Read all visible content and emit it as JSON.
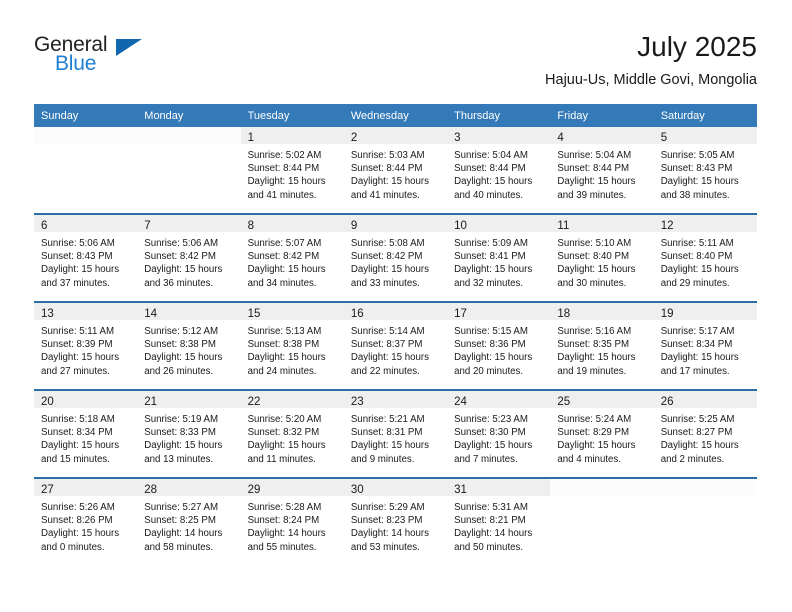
{
  "brand": {
    "name_part1": "General",
    "name_part2": "Blue",
    "triangle_color": "#1266ad",
    "blue_text_color": "#1c7fd4"
  },
  "header": {
    "month_title": "July 2025",
    "location": "Hajuu-Us, Middle Govi, Mongolia",
    "header_bg_color": "#3479b8",
    "row_divider_color": "#2d6ca5",
    "daynum_strip_color": "#efefef"
  },
  "weekday_headers": [
    "Sunday",
    "Monday",
    "Tuesday",
    "Wednesday",
    "Thursday",
    "Friday",
    "Saturday"
  ],
  "labels": {
    "sunrise_prefix": "Sunrise:",
    "sunset_prefix": "Sunset:",
    "daylight_prefix": "Daylight:"
  },
  "weeks": [
    [
      {
        "empty": true
      },
      {
        "empty": true
      },
      {
        "day": "1",
        "sunrise": "Sunrise: 5:02 AM",
        "sunset": "Sunset: 8:44 PM",
        "daylight_line1": "Daylight: 15 hours",
        "daylight_line2": "and 41 minutes."
      },
      {
        "day": "2",
        "sunrise": "Sunrise: 5:03 AM",
        "sunset": "Sunset: 8:44 PM",
        "daylight_line1": "Daylight: 15 hours",
        "daylight_line2": "and 41 minutes."
      },
      {
        "day": "3",
        "sunrise": "Sunrise: 5:04 AM",
        "sunset": "Sunset: 8:44 PM",
        "daylight_line1": "Daylight: 15 hours",
        "daylight_line2": "and 40 minutes."
      },
      {
        "day": "4",
        "sunrise": "Sunrise: 5:04 AM",
        "sunset": "Sunset: 8:44 PM",
        "daylight_line1": "Daylight: 15 hours",
        "daylight_line2": "and 39 minutes."
      },
      {
        "day": "5",
        "sunrise": "Sunrise: 5:05 AM",
        "sunset": "Sunset: 8:43 PM",
        "daylight_line1": "Daylight: 15 hours",
        "daylight_line2": "and 38 minutes."
      }
    ],
    [
      {
        "day": "6",
        "sunrise": "Sunrise: 5:06 AM",
        "sunset": "Sunset: 8:43 PM",
        "daylight_line1": "Daylight: 15 hours",
        "daylight_line2": "and 37 minutes."
      },
      {
        "day": "7",
        "sunrise": "Sunrise: 5:06 AM",
        "sunset": "Sunset: 8:42 PM",
        "daylight_line1": "Daylight: 15 hours",
        "daylight_line2": "and 36 minutes."
      },
      {
        "day": "8",
        "sunrise": "Sunrise: 5:07 AM",
        "sunset": "Sunset: 8:42 PM",
        "daylight_line1": "Daylight: 15 hours",
        "daylight_line2": "and 34 minutes."
      },
      {
        "day": "9",
        "sunrise": "Sunrise: 5:08 AM",
        "sunset": "Sunset: 8:42 PM",
        "daylight_line1": "Daylight: 15 hours",
        "daylight_line2": "and 33 minutes."
      },
      {
        "day": "10",
        "sunrise": "Sunrise: 5:09 AM",
        "sunset": "Sunset: 8:41 PM",
        "daylight_line1": "Daylight: 15 hours",
        "daylight_line2": "and 32 minutes."
      },
      {
        "day": "11",
        "sunrise": "Sunrise: 5:10 AM",
        "sunset": "Sunset: 8:40 PM",
        "daylight_line1": "Daylight: 15 hours",
        "daylight_line2": "and 30 minutes."
      },
      {
        "day": "12",
        "sunrise": "Sunrise: 5:11 AM",
        "sunset": "Sunset: 8:40 PM",
        "daylight_line1": "Daylight: 15 hours",
        "daylight_line2": "and 29 minutes."
      }
    ],
    [
      {
        "day": "13",
        "sunrise": "Sunrise: 5:11 AM",
        "sunset": "Sunset: 8:39 PM",
        "daylight_line1": "Daylight: 15 hours",
        "daylight_line2": "and 27 minutes."
      },
      {
        "day": "14",
        "sunrise": "Sunrise: 5:12 AM",
        "sunset": "Sunset: 8:38 PM",
        "daylight_line1": "Daylight: 15 hours",
        "daylight_line2": "and 26 minutes."
      },
      {
        "day": "15",
        "sunrise": "Sunrise: 5:13 AM",
        "sunset": "Sunset: 8:38 PM",
        "daylight_line1": "Daylight: 15 hours",
        "daylight_line2": "and 24 minutes."
      },
      {
        "day": "16",
        "sunrise": "Sunrise: 5:14 AM",
        "sunset": "Sunset: 8:37 PM",
        "daylight_line1": "Daylight: 15 hours",
        "daylight_line2": "and 22 minutes."
      },
      {
        "day": "17",
        "sunrise": "Sunrise: 5:15 AM",
        "sunset": "Sunset: 8:36 PM",
        "daylight_line1": "Daylight: 15 hours",
        "daylight_line2": "and 20 minutes."
      },
      {
        "day": "18",
        "sunrise": "Sunrise: 5:16 AM",
        "sunset": "Sunset: 8:35 PM",
        "daylight_line1": "Daylight: 15 hours",
        "daylight_line2": "and 19 minutes."
      },
      {
        "day": "19",
        "sunrise": "Sunrise: 5:17 AM",
        "sunset": "Sunset: 8:34 PM",
        "daylight_line1": "Daylight: 15 hours",
        "daylight_line2": "and 17 minutes."
      }
    ],
    [
      {
        "day": "20",
        "sunrise": "Sunrise: 5:18 AM",
        "sunset": "Sunset: 8:34 PM",
        "daylight_line1": "Daylight: 15 hours",
        "daylight_line2": "and 15 minutes."
      },
      {
        "day": "21",
        "sunrise": "Sunrise: 5:19 AM",
        "sunset": "Sunset: 8:33 PM",
        "daylight_line1": "Daylight: 15 hours",
        "daylight_line2": "and 13 minutes."
      },
      {
        "day": "22",
        "sunrise": "Sunrise: 5:20 AM",
        "sunset": "Sunset: 8:32 PM",
        "daylight_line1": "Daylight: 15 hours",
        "daylight_line2": "and 11 minutes."
      },
      {
        "day": "23",
        "sunrise": "Sunrise: 5:21 AM",
        "sunset": "Sunset: 8:31 PM",
        "daylight_line1": "Daylight: 15 hours",
        "daylight_line2": "and 9 minutes."
      },
      {
        "day": "24",
        "sunrise": "Sunrise: 5:23 AM",
        "sunset": "Sunset: 8:30 PM",
        "daylight_line1": "Daylight: 15 hours",
        "daylight_line2": "and 7 minutes."
      },
      {
        "day": "25",
        "sunrise": "Sunrise: 5:24 AM",
        "sunset": "Sunset: 8:29 PM",
        "daylight_line1": "Daylight: 15 hours",
        "daylight_line2": "and 4 minutes."
      },
      {
        "day": "26",
        "sunrise": "Sunrise: 5:25 AM",
        "sunset": "Sunset: 8:27 PM",
        "daylight_line1": "Daylight: 15 hours",
        "daylight_line2": "and 2 minutes."
      }
    ],
    [
      {
        "day": "27",
        "sunrise": "Sunrise: 5:26 AM",
        "sunset": "Sunset: 8:26 PM",
        "daylight_line1": "Daylight: 15 hours",
        "daylight_line2": "and 0 minutes."
      },
      {
        "day": "28",
        "sunrise": "Sunrise: 5:27 AM",
        "sunset": "Sunset: 8:25 PM",
        "daylight_line1": "Daylight: 14 hours",
        "daylight_line2": "and 58 minutes."
      },
      {
        "day": "29",
        "sunrise": "Sunrise: 5:28 AM",
        "sunset": "Sunset: 8:24 PM",
        "daylight_line1": "Daylight: 14 hours",
        "daylight_line2": "and 55 minutes."
      },
      {
        "day": "30",
        "sunrise": "Sunrise: 5:29 AM",
        "sunset": "Sunset: 8:23 PM",
        "daylight_line1": "Daylight: 14 hours",
        "daylight_line2": "and 53 minutes."
      },
      {
        "day": "31",
        "sunrise": "Sunrise: 5:31 AM",
        "sunset": "Sunset: 8:21 PM",
        "daylight_line1": "Daylight: 14 hours",
        "daylight_line2": "and 50 minutes."
      },
      {
        "empty": true
      },
      {
        "empty": true
      }
    ]
  ]
}
